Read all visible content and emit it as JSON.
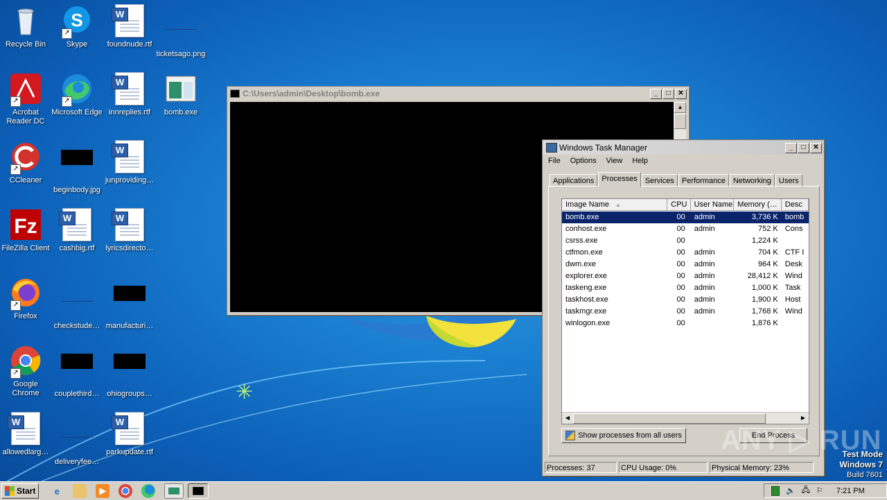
{
  "desktop": {
    "icons": [
      {
        "label": "Recycle Bin"
      },
      {
        "label": "Skype"
      },
      {
        "label": "foundnude.rtf"
      },
      {
        "label": "ticketsago.png"
      },
      {
        "label": "Acrobat\nReader DC"
      },
      {
        "label": "Microsoft Edge"
      },
      {
        "label": "innreplies.rtf"
      },
      {
        "label": "bomb.exe"
      },
      {
        "label": "CCleaner"
      },
      {
        "label": "beginbody.jpg"
      },
      {
        "label": "junproviding…"
      },
      {
        "label": "FileZilla Client"
      },
      {
        "label": "cashbig.rtf"
      },
      {
        "label": "lyricsdirecto…"
      },
      {
        "label": "Firefox"
      },
      {
        "label": "checkstude…"
      },
      {
        "label": "manufacturi…"
      },
      {
        "label": "Google\nChrome"
      },
      {
        "label": "couplethird…"
      },
      {
        "label": "ohiogroups…"
      },
      {
        "label": "allowedlarg…"
      },
      {
        "label": "deliveryfee…"
      },
      {
        "label": "parkupdate.rtf"
      }
    ]
  },
  "console": {
    "title": "C:\\Users\\admin\\Desktop\\bomb.exe"
  },
  "task_manager": {
    "title": "Windows Task Manager",
    "menu": [
      "File",
      "Options",
      "View",
      "Help"
    ],
    "tabs": [
      "Applications",
      "Processes",
      "Services",
      "Performance",
      "Networking",
      "Users"
    ],
    "active_tab": "Processes",
    "columns": [
      "Image Name",
      "CPU",
      "User Name",
      "Memory (…",
      "Desc"
    ],
    "rows": [
      {
        "name": "bomb.exe",
        "cpu": "00",
        "user": "admin",
        "mem": "3,736 K",
        "desc": "bomb"
      },
      {
        "name": "conhost.exe",
        "cpu": "00",
        "user": "admin",
        "mem": "752 K",
        "desc": "Cons"
      },
      {
        "name": "csrss.exe",
        "cpu": "00",
        "user": "",
        "mem": "1,224 K",
        "desc": ""
      },
      {
        "name": "ctfmon.exe",
        "cpu": "00",
        "user": "admin",
        "mem": "704 K",
        "desc": "CTF I"
      },
      {
        "name": "dwm.exe",
        "cpu": "00",
        "user": "admin",
        "mem": "964 K",
        "desc": "Desk"
      },
      {
        "name": "explorer.exe",
        "cpu": "00",
        "user": "admin",
        "mem": "28,412 K",
        "desc": "Wind"
      },
      {
        "name": "taskeng.exe",
        "cpu": "00",
        "user": "admin",
        "mem": "1,000 K",
        "desc": "Task"
      },
      {
        "name": "taskhost.exe",
        "cpu": "00",
        "user": "admin",
        "mem": "1,900 K",
        "desc": "Host"
      },
      {
        "name": "taskmgr.exe",
        "cpu": "00",
        "user": "admin",
        "mem": "1,768 K",
        "desc": "Wind"
      },
      {
        "name": "winlogon.exe",
        "cpu": "00",
        "user": "",
        "mem": "1,876 K",
        "desc": ""
      }
    ],
    "show_all_label": "Show processes from all users",
    "end_process_label": "End Process",
    "status": {
      "processes": "Processes: 37",
      "cpu": "CPU Usage: 0%",
      "memory": "Physical Memory: 23%"
    }
  },
  "watermark": "ANY ▷ RUN",
  "test_mode": {
    "line1": "Test Mode",
    "line2": "Windows 7",
    "line3": "Build 7601"
  },
  "taskbar": {
    "start_label": "Start",
    "clock": "7:21 PM"
  }
}
